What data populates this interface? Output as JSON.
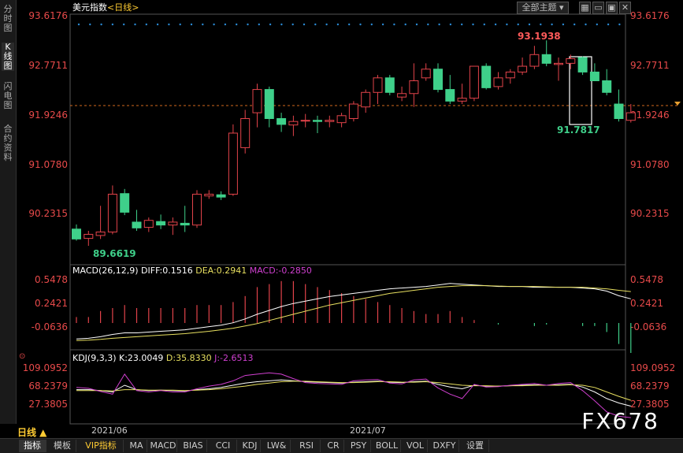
{
  "sidebar": {
    "tabs": [
      {
        "label": "分时图",
        "active": false
      },
      {
        "label": "K线图",
        "active": true
      },
      {
        "label": "闪电图",
        "active": false
      },
      {
        "label": "合约资料",
        "active": false
      }
    ]
  },
  "header": {
    "title": "美元指数",
    "period_tag": "<日线>",
    "theme_button": "全部主题"
  },
  "colors": {
    "up": "#e2434a",
    "down": "#3fd08a",
    "ma_white": "#ffffff",
    "ma_yellow": "#e8e060",
    "kdj_k": "#ffffff",
    "kdj_d": "#e8e060",
    "kdj_j": "#d040d0",
    "price_axis": "#e84a4a",
    "dashed_line": "#d2691e"
  },
  "price_panel": {
    "y_ticks": [
      "93.6176",
      "92.7711",
      "91.9246",
      "91.0780",
      "90.2315"
    ],
    "annotations": {
      "high": "93.1938",
      "low": "89.6619",
      "recent_low": "91.7817"
    }
  },
  "macd_panel": {
    "label": "MACD(26,12,9)",
    "diff": "DIFF:0.1516",
    "dea": "DEA:0.2941",
    "macd": "MACD:-0.2850",
    "y_ticks": [
      "0.5478",
      "0.2421",
      "-0.0636"
    ]
  },
  "kdj_panel": {
    "label": "KDJ(9,3,3)",
    "k": "K:23.0049",
    "d": "D:35.8330",
    "j": "J:-2.6513",
    "y_ticks": [
      "109.0952",
      "68.2379",
      "27.3805"
    ]
  },
  "footer": {
    "period": "日线 ▲",
    "dates": [
      "2021/06",
      "2021/07"
    ],
    "tabs": [
      "指标",
      "模板",
      "VIP指标",
      "MA",
      "MACD",
      "BIAS",
      "CCI",
      "KDJ",
      "LW&",
      "RSI",
      "CR",
      "PSY",
      "BOLL",
      "VOL",
      "DXFY",
      "设置"
    ],
    "watermark": "FX678"
  },
  "chart_data": [
    {
      "type": "candlestick",
      "title": "美元指数 <日线>",
      "y_range": [
        89.6619,
        93.6176
      ],
      "candles": [
        {
          "o": 89.95,
          "h": 90.03,
          "l": 89.75,
          "c": 89.78
        },
        {
          "o": 89.79,
          "h": 89.92,
          "l": 89.6619,
          "c": 89.86
        },
        {
          "o": 89.84,
          "h": 90.35,
          "l": 89.78,
          "c": 89.9
        },
        {
          "o": 89.9,
          "h": 90.7,
          "l": 89.86,
          "c": 90.55
        },
        {
          "o": 90.56,
          "h": 90.64,
          "l": 90.19,
          "c": 90.24
        },
        {
          "o": 90.07,
          "h": 90.28,
          "l": 89.92,
          "c": 89.97
        },
        {
          "o": 89.98,
          "h": 90.15,
          "l": 89.9,
          "c": 90.1
        },
        {
          "o": 90.08,
          "h": 90.2,
          "l": 89.95,
          "c": 90.02
        },
        {
          "o": 90.02,
          "h": 90.15,
          "l": 89.85,
          "c": 90.07
        },
        {
          "o": 90.05,
          "h": 90.35,
          "l": 89.9,
          "c": 90.02
        },
        {
          "o": 90.02,
          "h": 90.62,
          "l": 89.97,
          "c": 90.55
        },
        {
          "o": 90.52,
          "h": 90.62,
          "l": 90.47,
          "c": 90.55
        },
        {
          "o": 90.54,
          "h": 90.6,
          "l": 90.45,
          "c": 90.5
        },
        {
          "o": 90.55,
          "h": 91.75,
          "l": 90.52,
          "c": 91.6
        },
        {
          "o": 91.35,
          "h": 92.0,
          "l": 91.25,
          "c": 91.85
        },
        {
          "o": 91.95,
          "h": 92.45,
          "l": 91.7,
          "c": 92.35
        },
        {
          "o": 92.35,
          "h": 92.4,
          "l": 91.7,
          "c": 91.85
        },
        {
          "o": 91.85,
          "h": 91.95,
          "l": 91.62,
          "c": 91.75
        },
        {
          "o": 91.74,
          "h": 91.9,
          "l": 91.55,
          "c": 91.8
        },
        {
          "o": 91.82,
          "h": 91.93,
          "l": 91.7,
          "c": 91.82
        },
        {
          "o": 91.82,
          "h": 91.9,
          "l": 91.6,
          "c": 91.8
        },
        {
          "o": 91.8,
          "h": 91.9,
          "l": 91.7,
          "c": 91.82
        },
        {
          "o": 91.78,
          "h": 91.95,
          "l": 91.7,
          "c": 91.9
        },
        {
          "o": 91.85,
          "h": 92.15,
          "l": 91.8,
          "c": 92.1
        },
        {
          "o": 92.05,
          "h": 92.35,
          "l": 91.95,
          "c": 92.3
        },
        {
          "o": 92.3,
          "h": 92.6,
          "l": 92.1,
          "c": 92.55
        },
        {
          "o": 92.55,
          "h": 92.6,
          "l": 92.25,
          "c": 92.3
        },
        {
          "o": 92.22,
          "h": 92.4,
          "l": 92.15,
          "c": 92.28
        },
        {
          "o": 92.28,
          "h": 92.8,
          "l": 92.05,
          "c": 92.5
        },
        {
          "o": 92.55,
          "h": 92.8,
          "l": 92.5,
          "c": 92.7
        },
        {
          "o": 92.7,
          "h": 92.8,
          "l": 92.3,
          "c": 92.35
        },
        {
          "o": 92.35,
          "h": 92.6,
          "l": 92.1,
          "c": 92.15
        },
        {
          "o": 92.15,
          "h": 92.45,
          "l": 92.1,
          "c": 92.2
        },
        {
          "o": 92.2,
          "h": 92.75,
          "l": 92.15,
          "c": 92.75
        },
        {
          "o": 92.75,
          "h": 92.8,
          "l": 92.35,
          "c": 92.38
        },
        {
          "o": 92.4,
          "h": 92.65,
          "l": 92.35,
          "c": 92.55
        },
        {
          "o": 92.55,
          "h": 92.7,
          "l": 92.45,
          "c": 92.65
        },
        {
          "o": 92.65,
          "h": 92.9,
          "l": 92.6,
          "c": 92.75
        },
        {
          "o": 92.75,
          "h": 93.1,
          "l": 92.7,
          "c": 92.95
        },
        {
          "o": 92.95,
          "h": 93.1938,
          "l": 92.75,
          "c": 92.8
        },
        {
          "o": 92.78,
          "h": 92.9,
          "l": 92.5,
          "c": 92.8
        },
        {
          "o": 92.8,
          "h": 92.95,
          "l": 92.7,
          "c": 92.88
        },
        {
          "o": 92.9,
          "h": 92.92,
          "l": 92.6,
          "c": 92.65
        },
        {
          "o": 92.65,
          "h": 92.8,
          "l": 92.5,
          "c": 92.5
        },
        {
          "o": 92.5,
          "h": 92.7,
          "l": 92.25,
          "c": 92.3
        },
        {
          "o": 92.1,
          "h": 92.35,
          "l": 91.8,
          "c": 91.85
        },
        {
          "o": 91.82,
          "h": 92.1,
          "l": 91.7817,
          "c": 91.95
        }
      ]
    },
    {
      "type": "line",
      "title": "MACD(26,12,9)",
      "y_range": [
        -0.36,
        0.6
      ],
      "series": [
        {
          "name": "DIFF",
          "values": [
            -0.22,
            -0.21,
            -0.19,
            -0.16,
            -0.14,
            -0.14,
            -0.13,
            -0.12,
            -0.11,
            -0.1,
            -0.08,
            -0.06,
            -0.04,
            -0.01,
            0.04,
            0.1,
            0.15,
            0.2,
            0.24,
            0.27,
            0.3,
            0.33,
            0.35,
            0.37,
            0.39,
            0.41,
            0.43,
            0.44,
            0.45,
            0.46,
            0.48,
            0.5,
            0.49,
            0.48,
            0.47,
            0.46,
            0.46,
            0.46,
            0.45,
            0.45,
            0.45,
            0.45,
            0.44,
            0.43,
            0.4,
            0.34,
            0.3
          ]
        },
        {
          "name": "DEA",
          "values": [
            -0.24,
            -0.235,
            -0.225,
            -0.21,
            -0.2,
            -0.19,
            -0.18,
            -0.17,
            -0.16,
            -0.15,
            -0.135,
            -0.12,
            -0.1,
            -0.08,
            -0.05,
            -0.02,
            0.02,
            0.06,
            0.1,
            0.14,
            0.18,
            0.22,
            0.25,
            0.28,
            0.31,
            0.34,
            0.37,
            0.39,
            0.41,
            0.43,
            0.45,
            0.46,
            0.47,
            0.47,
            0.47,
            0.465,
            0.46,
            0.46,
            0.46,
            0.455,
            0.45,
            0.45,
            0.45,
            0.44,
            0.43,
            0.41,
            0.3941
          ]
        },
        {
          "name": "MACD",
          "values": [
            0.02,
            0.02,
            0.04,
            0.05,
            0.06,
            0.05,
            0.05,
            0.05,
            0.05,
            0.05,
            0.06,
            0.06,
            0.06,
            0.07,
            0.09,
            0.12,
            0.13,
            0.14,
            0.14,
            0.13,
            0.12,
            0.11,
            0.1,
            0.09,
            0.08,
            0.07,
            0.06,
            0.05,
            0.04,
            0.03,
            0.03,
            0.04,
            0.02,
            0.01,
            0.0,
            -0.005,
            0.0,
            0.0,
            -0.01,
            -0.005,
            0.0,
            0.0,
            -0.01,
            -0.01,
            -0.03,
            -0.07,
            -0.1
          ]
        }
      ]
    },
    {
      "type": "line",
      "title": "KDJ(9,3,3)",
      "y_range": [
        0,
        125
      ],
      "series": [
        {
          "name": "K",
          "values": [
            60,
            60,
            58,
            55,
            70,
            60,
            58,
            59,
            58,
            57,
            60,
            62,
            65,
            70,
            75,
            78,
            80,
            82,
            80,
            78,
            77,
            76,
            75,
            77,
            78,
            79,
            77,
            76,
            78,
            79,
            72,
            66,
            62,
            70,
            68,
            68,
            69,
            70,
            71,
            70,
            71,
            72,
            66,
            55,
            40,
            30,
            23
          ]
        },
        {
          "name": "D",
          "values": [
            58,
            58,
            58,
            57,
            60,
            60,
            59,
            59,
            59,
            58,
            59,
            60,
            62,
            65,
            68,
            72,
            75,
            78,
            79,
            79,
            78,
            77,
            76,
            76,
            77,
            78,
            78,
            77,
            77,
            78,
            76,
            73,
            70,
            69,
            69,
            68,
            69,
            69,
            70,
            70,
            70,
            71,
            70,
            65,
            55,
            45,
            36
          ]
        },
        {
          "name": "J",
          "values": [
            65,
            63,
            56,
            50,
            95,
            58,
            55,
            58,
            55,
            55,
            62,
            68,
            72,
            80,
            92,
            95,
            98,
            95,
            85,
            76,
            74,
            73,
            72,
            80,
            82,
            83,
            75,
            73,
            82,
            84,
            64,
            50,
            40,
            72,
            66,
            67,
            70,
            72,
            74,
            70,
            74,
            76,
            58,
            35,
            10,
            0,
            -3
          ]
        }
      ]
    }
  ]
}
